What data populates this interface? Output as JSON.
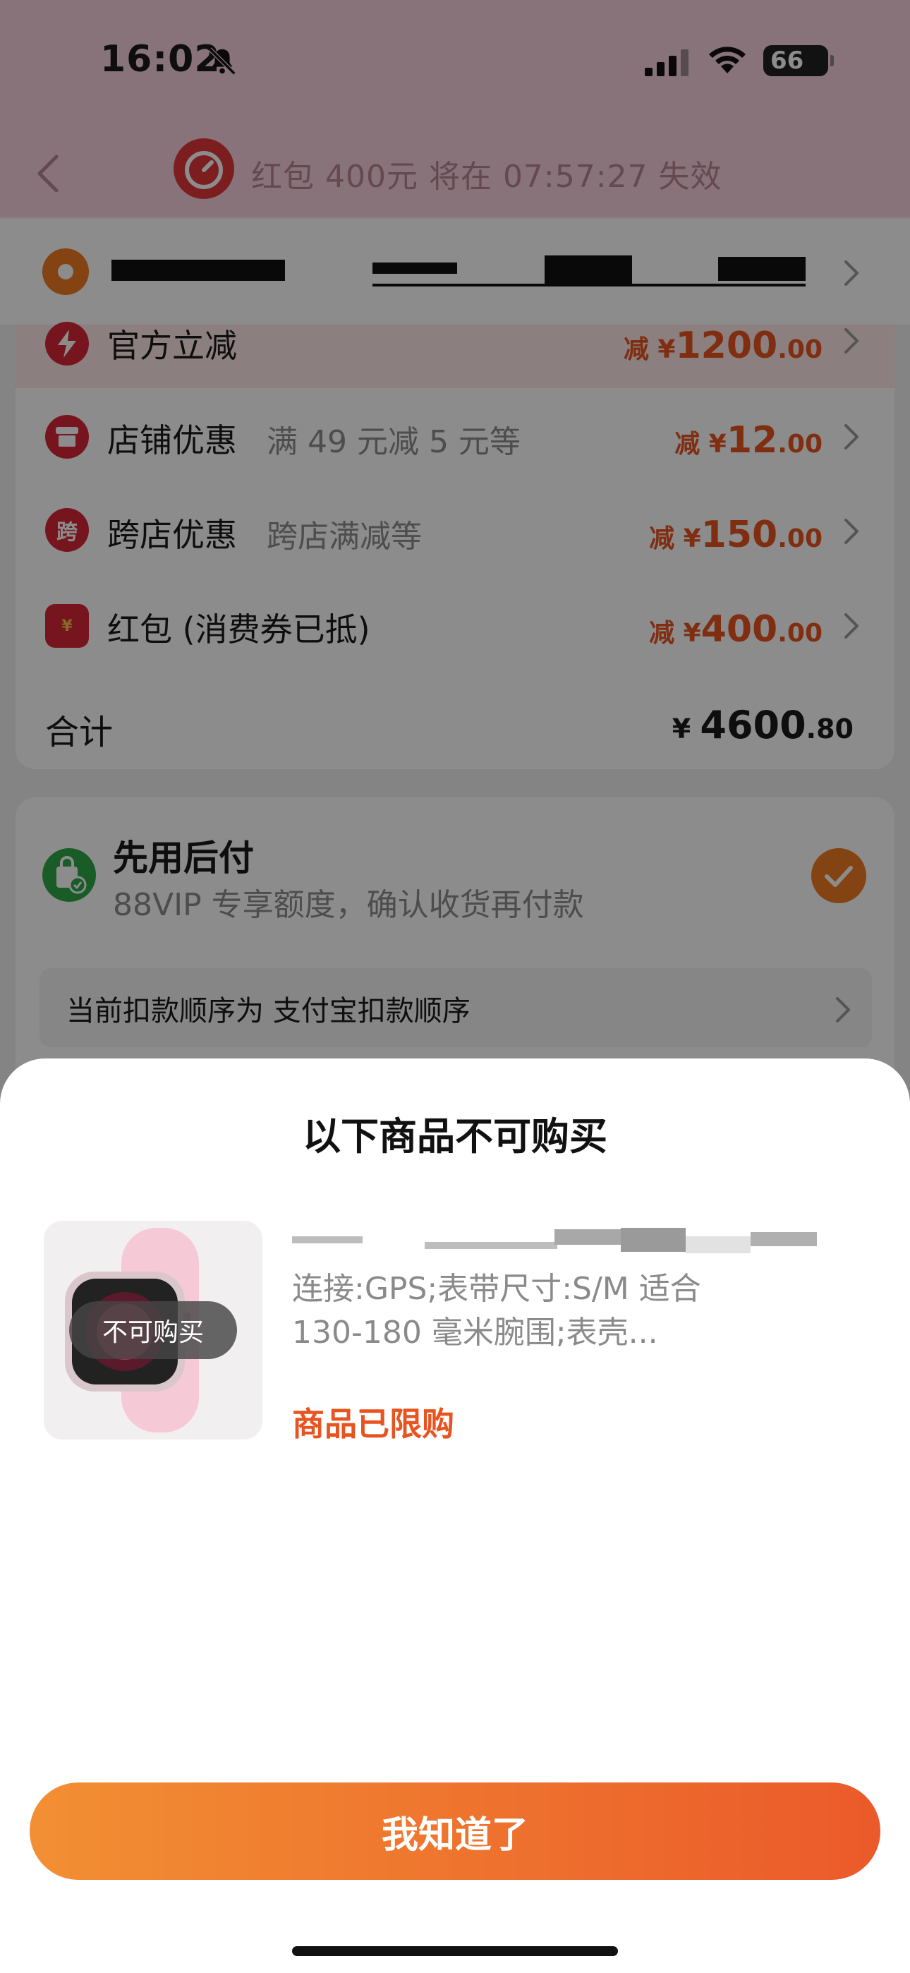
{
  "status_bar": {
    "time": "16:02",
    "battery": "66"
  },
  "header": {
    "countdown_text": "红包 400元 将在 07:57:27 失效"
  },
  "discounts": [
    {
      "label": "官方立减",
      "sub": "",
      "prefix": "减 ¥",
      "int": "1200",
      "dec": ".00"
    },
    {
      "label": "店铺优惠",
      "sub": "满 49 元减 5 元等",
      "prefix": "减 ¥",
      "int": "12",
      "dec": ".00"
    },
    {
      "label": "跨店优惠",
      "sub": "跨店满减等",
      "prefix": "减 ¥",
      "int": "150",
      "dec": ".00"
    },
    {
      "label": "红包 (消费券已抵)",
      "sub": "",
      "prefix": "减 ¥",
      "int": "400",
      "dec": ".00"
    }
  ],
  "discount_icons": {
    "cross_store": "跨",
    "redpack": "¥"
  },
  "total": {
    "label": "合计",
    "prefix": "¥ ",
    "int": "4600",
    "dec": ".80"
  },
  "bnpl": {
    "title": "先用后付",
    "subtitle": "88VIP 专享额度，确认收货再付款",
    "order_text": "当前扣款顺序为 支付宝扣款顺序"
  },
  "modal": {
    "title": "以下商品不可购买",
    "badge": "不可购买",
    "spec_line1": "连接:GPS;表带尺寸:S/M 适合",
    "spec_line2": "130-180 毫米腕围;表壳...",
    "limit_text": "商品已限购",
    "ok_button": "我知道了"
  },
  "colors": {
    "accent": "#e85420",
    "button_start": "#f28f33",
    "button_end": "#eb5a2a",
    "header_bg": "#f6d2dc"
  }
}
